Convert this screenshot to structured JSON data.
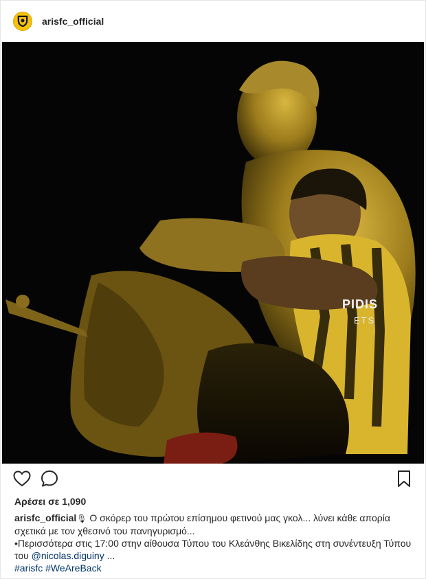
{
  "post": {
    "username": "arisfc_official",
    "avatar_icon": "aris-fc-crest-icon",
    "brand_color": "#f4c20d",
    "likes_text": "Αρέσει σε 1,090",
    "caption": {
      "username": "arisfc_official",
      "emoji": "🎙",
      "line1": " Ο σκόρερ του πρώτου επίσημου φετινού μας γκολ... λύνει κάθε απορία σχετικά με τον χθεσινό του πανηγυρισμό...",
      "line2": "•Περισσότερα στις 17:00 στην αίθουσα Τύπου του Κλεάνθης Βικελίδης στη συνέντευξη Τύπου του ",
      "mention": "@nicolas.diguiny",
      "more": " ...",
      "hashtag1": "#arisfc",
      "hashtag2": "#WeAreBack"
    },
    "image": {
      "jersey_text": "PIDIS",
      "jersey_subtext": "ETS"
    },
    "icons": {
      "like": "heart-icon",
      "comment": "comment-bubble-icon",
      "save": "bookmark-icon"
    }
  }
}
